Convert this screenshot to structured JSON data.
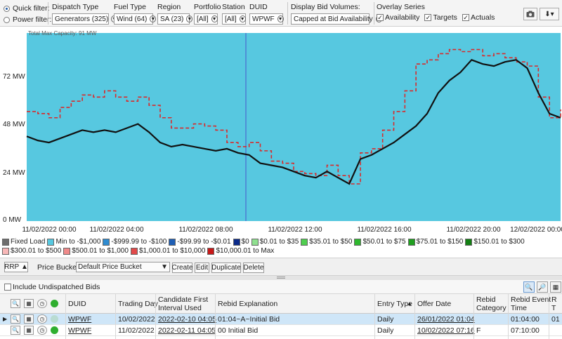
{
  "filters": {
    "quick_filter": "Quick filter:",
    "power_filter": "Power filter:",
    "dispatch_type": {
      "label": "Dispatch Type",
      "value": "Generators (325)"
    },
    "fuel_type": {
      "label": "Fuel Type",
      "value": "Wind (64)"
    },
    "region": {
      "label": "Region",
      "value": "SA (23)"
    },
    "portfolio": {
      "label": "Portfolio",
      "value": "[All]"
    },
    "station": {
      "label": "Station",
      "value": "[All]"
    },
    "duid": {
      "label": "DUID",
      "value": "WPWF"
    },
    "display_bid_volumes": {
      "label": "Display Bid Volumes:",
      "value": "Capped at Bid Availability"
    },
    "overlay": {
      "label": "Overlay Series",
      "availability": "Availability",
      "targets": "Targets",
      "actuals": "Actuals"
    }
  },
  "chart": {
    "caption": "Total Max Capacity: 91 MW",
    "y_ticks": [
      "72 MW",
      "48 MW",
      "24 MW",
      "0 MW"
    ],
    "x_ticks": [
      "11/02/2022 00:00",
      "11/02/2022 04:00",
      "11/02/2022 08:00",
      "11/02/2022 12:00",
      "11/02/2022 16:00",
      "11/02/2022 20:00",
      "12/02/2022 00:00"
    ],
    "colors": {
      "fill": "#57c8e0",
      "availability": "#d92b2b",
      "targets": "#111111",
      "marker": "#4f8fd6"
    }
  },
  "chart_data": {
    "type": "area",
    "title": "Total Max Capacity: 91 MW",
    "x_unit": "hours from 11/02/2022 00:00",
    "xlim": [
      0,
      24
    ],
    "ylim": [
      0,
      91
    ],
    "y_unit": "MW",
    "series": [
      {
        "name": "Availability",
        "x": [
          0,
          0.5,
          1,
          1.5,
          2,
          2.5,
          3,
          3.5,
          4,
          4.5,
          5,
          5.5,
          6,
          6.5,
          7,
          7.5,
          8,
          8.5,
          9,
          9.5,
          10,
          10.5,
          11,
          11.5,
          12,
          12.5,
          13,
          13.5,
          14,
          14.5,
          15,
          15.5,
          16,
          16.5,
          17,
          17.5,
          18,
          18.5,
          19,
          19.5,
          20,
          20.5,
          21,
          21.5,
          22,
          22.5,
          23,
          23.5,
          24
        ],
        "values": [
          53,
          52,
          50,
          55,
          58,
          61,
          60,
          63,
          60,
          58,
          60,
          56,
          50,
          45,
          45,
          47,
          46,
          44,
          38,
          36,
          38,
          34,
          29,
          28,
          24,
          23,
          22,
          27,
          22,
          18,
          33,
          35,
          44,
          53,
          63,
          76,
          78,
          81,
          83,
          82,
          83,
          80,
          81,
          79,
          77,
          75,
          60,
          50,
          54
        ]
      },
      {
        "name": "Targets",
        "x": [
          0,
          0.5,
          1,
          1.5,
          2,
          2.5,
          3,
          3.5,
          4,
          4.5,
          5,
          5.5,
          6,
          6.5,
          7,
          7.5,
          8,
          8.5,
          9,
          9.5,
          10,
          10.5,
          11,
          11.5,
          12,
          12.5,
          13,
          13.5,
          14,
          14.5,
          15,
          15.5,
          16,
          16.5,
          17,
          17.5,
          18,
          18.5,
          19,
          19.5,
          20,
          20.5,
          21,
          21.5,
          22,
          22.5,
          23,
          23.5,
          24
        ],
        "values": [
          41,
          39,
          38,
          40,
          42,
          44,
          43,
          44,
          43,
          45,
          47,
          43,
          38,
          36,
          37,
          36,
          35,
          34,
          35,
          33,
          32,
          28,
          27,
          26,
          24,
          22,
          21,
          24,
          21,
          18,
          30,
          32,
          35,
          38,
          42,
          46,
          52,
          62,
          68,
          72,
          78,
          76,
          75,
          77,
          78,
          74,
          62,
          52,
          50
        ]
      }
    ]
  },
  "legend": [
    {
      "label": "Fixed Load",
      "color": "#6e6e6e"
    },
    {
      "label": "Min to -$1,000",
      "color": "#57c8e0"
    },
    {
      "label": "-$999.99 to -$100",
      "color": "#2f8bd0"
    },
    {
      "label": "-$99.99 to -$0.01",
      "color": "#1f5fb5"
    },
    {
      "label": "$0",
      "color": "#0b2a8a"
    },
    {
      "label": "$0.01 to $35",
      "color": "#8fe08f"
    },
    {
      "label": "$35.01 to $50",
      "color": "#4fce4f"
    },
    {
      "label": "$50.01 to $75",
      "color": "#2fb82f"
    },
    {
      "label": "$75.01 to $150",
      "color": "#1f9f1f"
    },
    {
      "label": "$150.01 to $300",
      "color": "#137f13"
    },
    {
      "label": "$300.01 to $500",
      "color": "#f7b7b7"
    },
    {
      "label": "$500.01 to $1,000",
      "color": "#f08a8a"
    },
    {
      "label": "$1,000.01 to $10,000",
      "color": "#e24a4a"
    },
    {
      "label": "$10,000.01 to Max",
      "color": "#c81818"
    }
  ],
  "price_bar": {
    "rrp": "RRP",
    "buckets_label": "Price Buckets:",
    "bucket_value": "Default Price Bucket",
    "create": "Create",
    "edit": "Edit",
    "duplicate": "Duplicate",
    "delete": "Delete"
  },
  "grid": {
    "include_undispatched": "Include Undispatched Bids",
    "headers": {
      "duid": "DUID",
      "trading_day": "Trading Day",
      "candidate_1": "Candidate First",
      "candidate_2": "Interval Used",
      "rebid_explanation": "Rebid Explanation",
      "entry_type": "Entry Type",
      "offer_date": "Offer Date",
      "rebid_cat_1": "Rebid",
      "rebid_cat_2": "Category",
      "rebid_evt_1": "Rebid Event",
      "rebid_evt_2": "Time",
      "last_1": "R",
      "last_2": "T"
    },
    "rows": [
      {
        "duid": "WPWF",
        "trading_day": "10/02/2022",
        "candidate": "2022-02-10 04:05",
        "explanation": "01:04~A~Initial Bid",
        "entry_type": "Daily",
        "offer_date": "26/01/2022 01:04",
        "category": "",
        "event_time": "01:04:00",
        "last": "01"
      },
      {
        "duid": "WPWF",
        "trading_day": "11/02/2022",
        "candidate": "2022-02-11 04:05",
        "explanation": "00 Initial Bid",
        "entry_type": "Daily",
        "offer_date": "10/02/2022 07:16",
        "category": "F",
        "event_time": "07:10:00",
        "last": ""
      }
    ]
  }
}
